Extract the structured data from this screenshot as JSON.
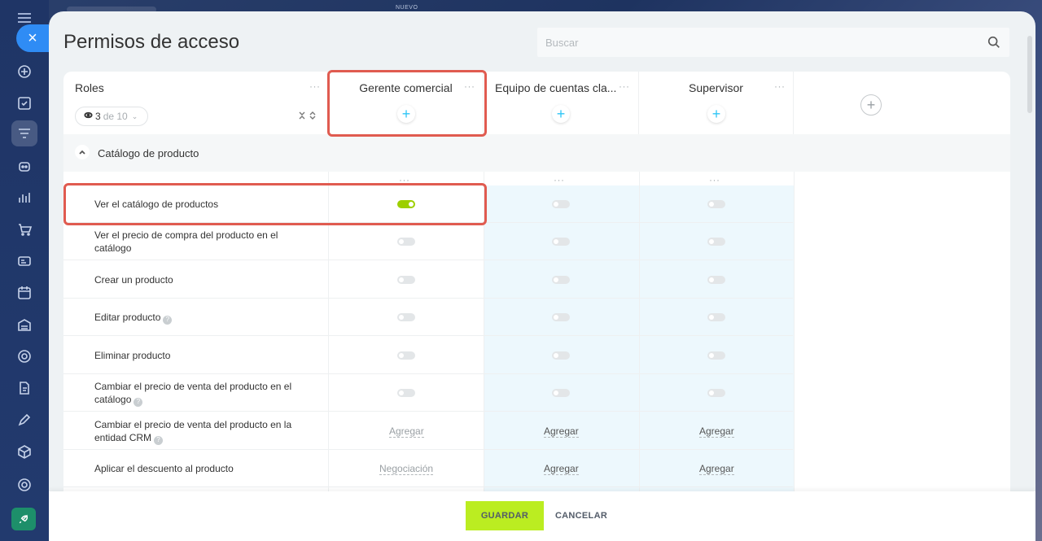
{
  "page": {
    "title": "Permisos de acceso",
    "top_tag": "NUEVO"
  },
  "search": {
    "placeholder": "Buscar"
  },
  "roles_header": {
    "label": "Roles",
    "count_shown": "3",
    "count_of": "de 10"
  },
  "columns": [
    {
      "name": "Gerente comercial"
    },
    {
      "name": "Equipo de cuentas cla..."
    },
    {
      "name": "Supervisor"
    }
  ],
  "section": {
    "label": "Catálogo de producto"
  },
  "rows": [
    {
      "label": "Ver el catálogo de productos",
      "type": "toggle",
      "values": [
        true,
        false,
        false
      ],
      "help": false
    },
    {
      "label": "Ver el precio de compra del producto en el catálogo",
      "type": "toggle",
      "values": [
        false,
        false,
        false
      ],
      "help": false
    },
    {
      "label": "Crear un producto",
      "type": "toggle",
      "values": [
        false,
        false,
        false
      ],
      "help": false
    },
    {
      "label": "Editar producto",
      "type": "toggle",
      "values": [
        false,
        false,
        false
      ],
      "help": true
    },
    {
      "label": "Eliminar producto",
      "type": "toggle",
      "values": [
        false,
        false,
        false
      ],
      "help": false
    },
    {
      "label": "Cambiar el precio de venta del producto en el catálogo",
      "type": "toggle",
      "values": [
        false,
        false,
        false
      ],
      "help": true
    },
    {
      "label": "Cambiar el precio de venta del producto en la entidad CRM",
      "type": "select",
      "values": [
        "Agregar",
        "Agregar",
        "Agregar"
      ],
      "help": true
    },
    {
      "label": "Aplicar el descuento al producto",
      "type": "select",
      "values": [
        "Negociación",
        "Agregar",
        "Agregar"
      ],
      "help": false
    }
  ],
  "footer": {
    "save_label": "GUARDAR",
    "cancel_label": "CANCELAR"
  },
  "colors": {
    "toggle_on": "#9dcf00",
    "save_button": "#bbed21",
    "highlight": "#e05b50",
    "accent_blue": "#2fc6f6"
  }
}
